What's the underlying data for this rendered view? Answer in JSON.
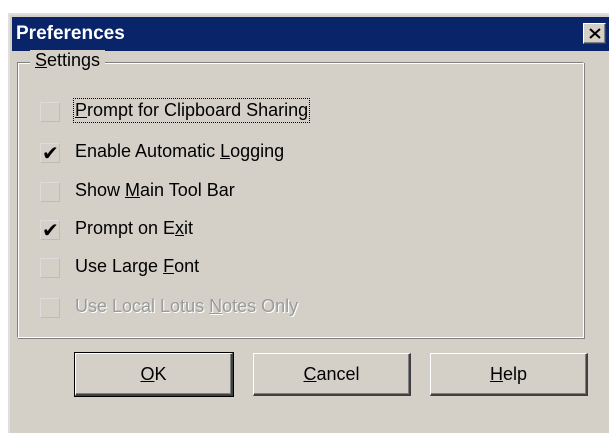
{
  "window": {
    "title": "Preferences",
    "close_icon": "close-icon",
    "colors": {
      "titlebar": "#0a246a",
      "face": "#d4d0c8"
    }
  },
  "settings": {
    "group_label": {
      "accel": "S",
      "rest": "ettings"
    },
    "items": [
      {
        "pre": "",
        "accel": "P",
        "post": "rompt for Clipboard Sharing",
        "checked": false,
        "enabled": true
      },
      {
        "pre": "Enable Automatic ",
        "accel": "L",
        "post": "ogging",
        "checked": true,
        "enabled": true
      },
      {
        "pre": "Show ",
        "accel": "M",
        "post": "ain Tool Bar",
        "checked": false,
        "enabled": true
      },
      {
        "pre": "Prompt on E",
        "accel": "x",
        "post": "it",
        "checked": true,
        "enabled": true
      },
      {
        "pre": "Use Large ",
        "accel": "F",
        "post": "ont",
        "checked": false,
        "enabled": true
      },
      {
        "pre": "Use Local Lotus ",
        "accel": "N",
        "post": "otes Only",
        "checked": false,
        "enabled": false
      }
    ]
  },
  "buttons": {
    "ok": {
      "accel": "O",
      "rest": "K"
    },
    "cancel": {
      "accel": "C",
      "rest": "ancel"
    },
    "help": {
      "accel": "H",
      "rest": "elp"
    }
  }
}
